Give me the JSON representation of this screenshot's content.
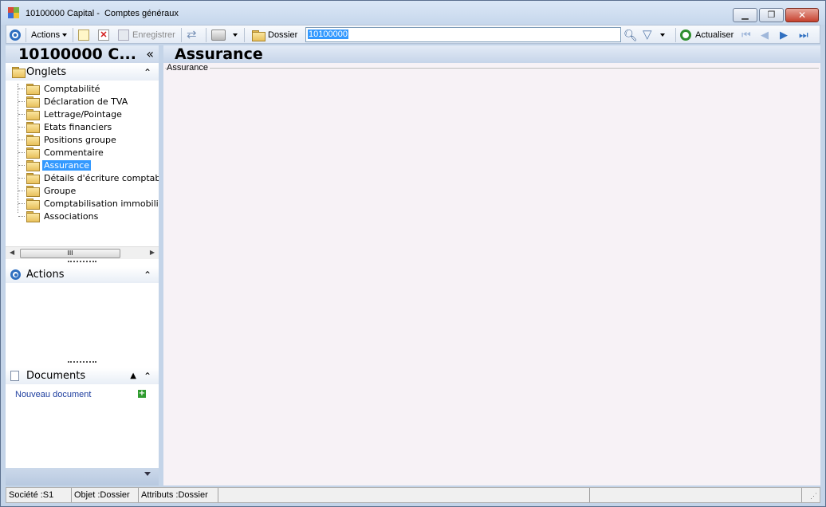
{
  "window": {
    "title_parts": [
      "10100000 Capital -",
      "Comptes généraux"
    ]
  },
  "toolbar": {
    "actions_label": "Actions",
    "save_label": "Enregistrer",
    "dossier_label": "Dossier",
    "search_value": "10100000",
    "refresh_label": "Actualiser"
  },
  "left_panel": {
    "title": "10100000 C...",
    "collapse_glyph": "«",
    "onglets_label": "Onglets",
    "tree_items": [
      "Comptabilité",
      "Déclaration de TVA",
      "Lettrage/Pointage",
      "Etats financiers",
      "Positions groupe",
      "Commentaire",
      "Assurance",
      "Détails d'écriture comptab",
      "Groupe",
      "Comptabilisation immobili",
      "Associations"
    ],
    "selected_item": "Assurance",
    "scroll_thumb_text": "III",
    "actions_section_label": "Actions",
    "documents_label": "Documents",
    "new_document_label": "Nouveau document"
  },
  "main": {
    "title": "Assurance",
    "group_label": "Assurance"
  },
  "statusbar": {
    "societe": "Société :S1",
    "objet": "Objet :Dossier",
    "attributs": "Attributs :Dossier"
  },
  "colors": {
    "selection": "#3399ff",
    "panel_header": "#c6d5e9",
    "link": "#1f3f9f"
  }
}
